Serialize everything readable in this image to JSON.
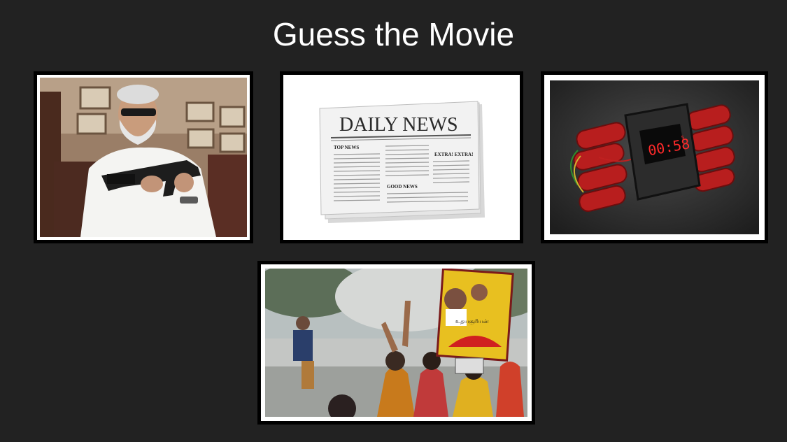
{
  "slide": {
    "title": "Guess the Movie"
  },
  "clues": [
    {
      "name": "clue-man-with-gun",
      "description_icon": "man-with-gun-photo"
    },
    {
      "name": "clue-newspaper",
      "headline": "DAILY NEWS",
      "section_top": "TOP NEWS",
      "section_extra": "EXTRA! EXTRA!",
      "section_good": "GOOD NEWS"
    },
    {
      "name": "clue-time-bomb",
      "timer": "00:58",
      "timer_small": "5"
    },
    {
      "name": "clue-celebration",
      "poster_text": "உதயசூரியன்"
    }
  ],
  "colors": {
    "background": "#222222",
    "frame_border": "#000000",
    "frame_mat": "#ffffff",
    "timer_red": "#ff2a2a"
  }
}
